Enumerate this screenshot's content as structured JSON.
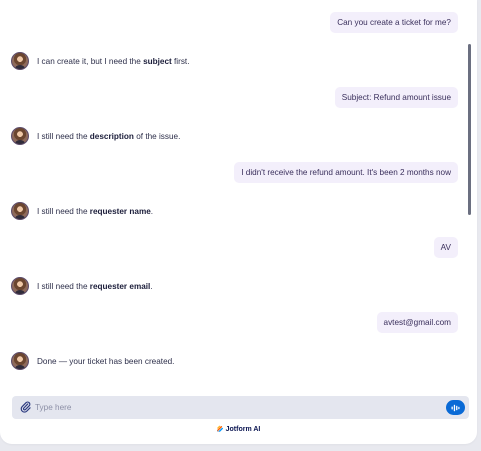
{
  "messages": [
    {
      "role": "user",
      "text": "Can you create a ticket for me?"
    },
    {
      "role": "bot",
      "before": "I can create it, but I need the ",
      "bold": "subject",
      "after": " first."
    },
    {
      "role": "user",
      "text": "Subject: Refund amount issue"
    },
    {
      "role": "bot",
      "before": "I still need the ",
      "bold": "description",
      "after": " of the issue."
    },
    {
      "role": "user",
      "text": "I didn't receive the refund amount. It's been 2 months now"
    },
    {
      "role": "bot",
      "before": "I still need the ",
      "bold": "requester name",
      "after": "."
    },
    {
      "role": "user",
      "text": "AV"
    },
    {
      "role": "bot",
      "before": "I still need the ",
      "bold": "requester email",
      "after": "."
    },
    {
      "role": "user",
      "text": "avtest@gmail.com"
    },
    {
      "role": "bot",
      "before": "Done — your ticket has been created.",
      "bold": "",
      "after": ""
    }
  ],
  "composer": {
    "placeholder": "Type here",
    "attach_icon": "paperclip-icon",
    "voice_icon": "waveform-icon"
  },
  "footer": {
    "brand": "Jotform AI"
  },
  "colors": {
    "accent": "#0a6ad6",
    "user_bubble": "#f3effb",
    "input_bg": "#e4e6ef",
    "brand_navy": "#0a1551"
  }
}
